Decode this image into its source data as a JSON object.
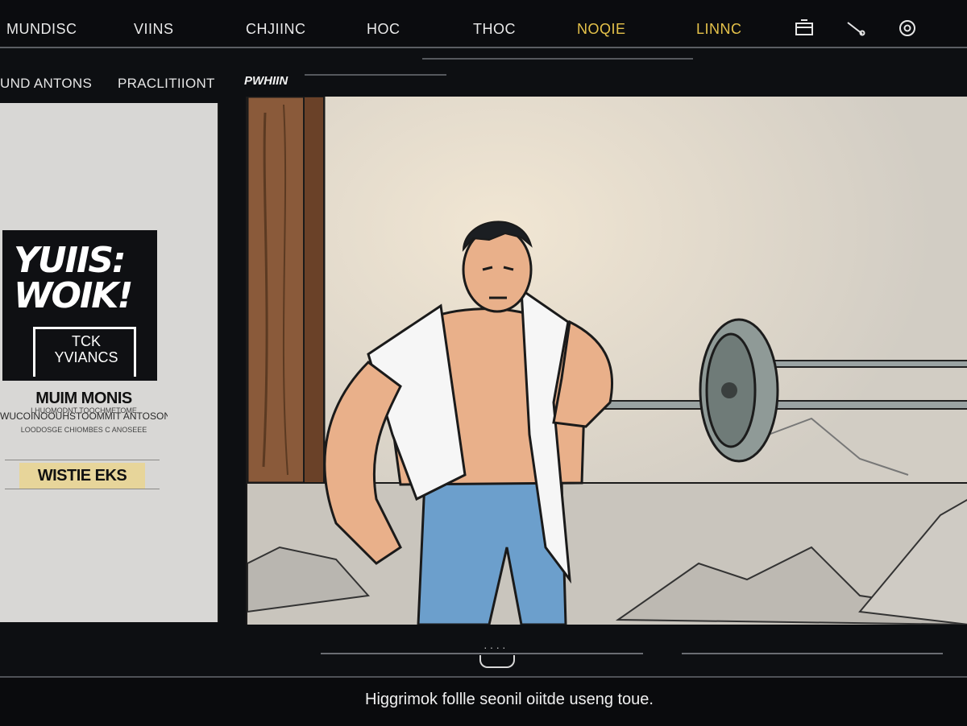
{
  "topnav": {
    "items": [
      "MUNDISC",
      "VIINS",
      "CHJIINC",
      "HOC",
      "THOC",
      "NOQIE",
      "LINNC"
    ],
    "accent_color": "#e5c24a",
    "icons": [
      "tray-icon",
      "pen-icon",
      "target-icon"
    ]
  },
  "subnav": {
    "items": [
      "UND ANTONS",
      "PRACLITIIONT"
    ],
    "panel_label": "PWHIIN"
  },
  "card": {
    "poster_title": "YUIIS:\nWOIK!",
    "poster_sub": "TCK\nYVIANCS",
    "heading": "MUIM MONIS",
    "line1": "WUCOINOOUHSTOOMMIT ANTOSONE.",
    "line2": "LHUOMODNT TOOCHMETOME",
    "line3": "LOODOSGE CHIOMBES C ANOSEEE",
    "cta": "WISTIE EKS",
    "cta_color": "#e7d59a"
  },
  "footer": {
    "caption": "Higgrimok follle seonil oiitde useng toue."
  }
}
